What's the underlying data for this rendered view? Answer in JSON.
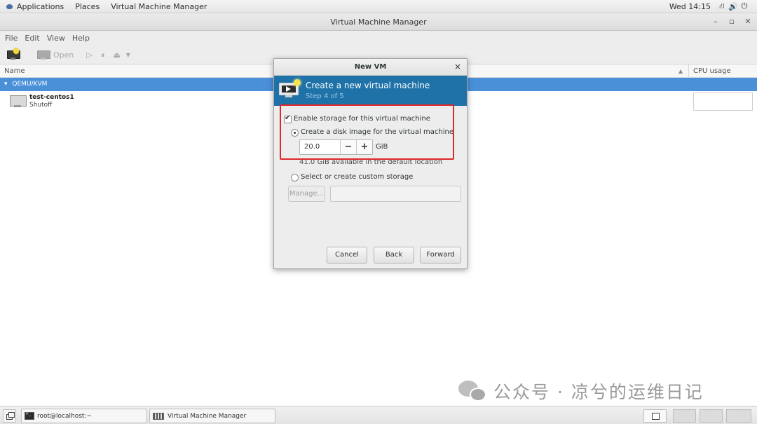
{
  "top_bar": {
    "applications": "Applications",
    "places": "Places",
    "active_app": "Virtual Machine Manager",
    "clock": "Wed 14:15",
    "network_icon": "network-icon",
    "volume_icon": "volume-icon",
    "power_icon": "power-icon"
  },
  "window": {
    "title": "Virtual Machine Manager",
    "controls": {
      "minimize": "–",
      "maximize": "▫",
      "close": "✕"
    }
  },
  "menubar": {
    "items": [
      "File",
      "Edit",
      "View",
      "Help"
    ]
  },
  "toolbar": {
    "open_label": "Open"
  },
  "vm_list": {
    "columns": {
      "name": "Name",
      "cpu": "CPU usage"
    },
    "connection": "QEMU/KVM",
    "vms": [
      {
        "name": "test-centos1",
        "state": "Shutoff"
      }
    ]
  },
  "dialog": {
    "title": "New VM",
    "close": "×",
    "header_title": "Create a new virtual machine",
    "step": "Step 4 of 5",
    "enable_storage": "Enable storage for this virtual machine",
    "create_disk": "Create a disk image for the virtual machine",
    "size_value": "20.0",
    "minus": "−",
    "plus": "+",
    "unit": "GiB",
    "available": "41.0 GiB available in the default location",
    "custom_storage": "Select or create custom storage",
    "manage": "Manage...",
    "path_value": "",
    "buttons": {
      "cancel": "Cancel",
      "back": "Back",
      "forward": "Forward"
    },
    "highlight_color": "#e0292a",
    "header_color": "#1e72a8"
  },
  "taskbar": {
    "terminal": "root@localhost:~",
    "vmm": "Virtual Machine Manager"
  },
  "watermark": {
    "text": "公众号 · 凉兮的运维日记"
  }
}
